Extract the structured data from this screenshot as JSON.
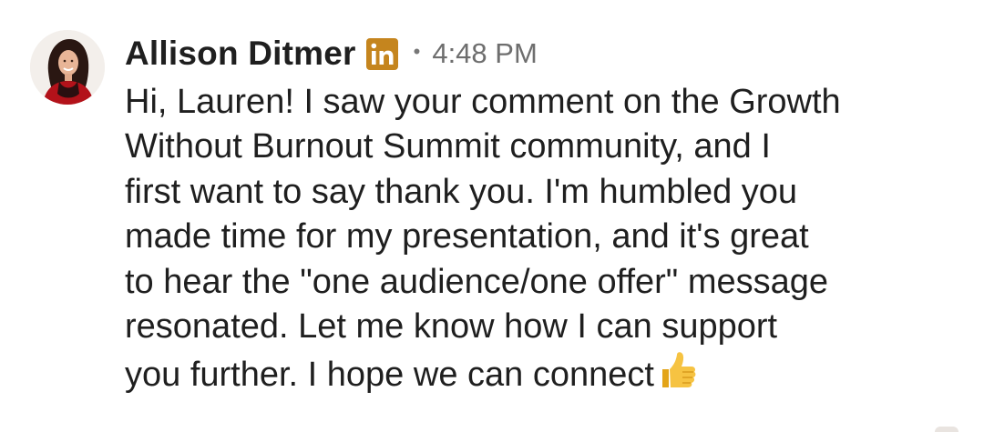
{
  "message": {
    "sender_name": "Allison Ditmer",
    "platform_badge": "in",
    "platform_icon": "linkedin-icon",
    "separator": "•",
    "timestamp": "4:48 PM",
    "body_lines": [
      "Hi, Lauren! I saw your comment on the Growth",
      "Without Burnout Summit community, and I",
      "first want to say thank you. I'm humbled you",
      "made time for my presentation, and it's great",
      "to hear the \"one audience/one offer\" message",
      "resonated. Let me know how I can support",
      "you further. I hope we can connect"
    ],
    "emoji": "thumbs-up-icon"
  },
  "colors": {
    "text": "#1f1f1f",
    "timestamp": "#6e6e6e",
    "linkedin_badge": "#c5851e",
    "emoji": "#f6c342",
    "background": "#ffffff"
  }
}
